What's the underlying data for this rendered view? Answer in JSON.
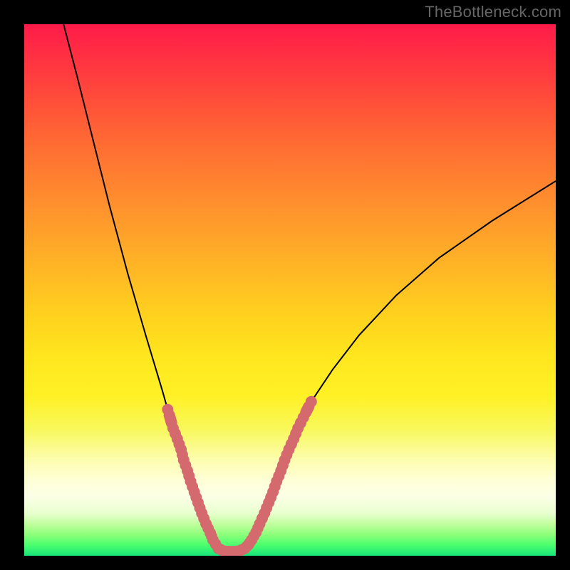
{
  "attribution": "TheBottleneck.com",
  "chart_data": {
    "type": "line",
    "title": "",
    "xlabel": "",
    "ylabel": "",
    "xlim": [
      0,
      100
    ],
    "ylim": [
      0,
      100
    ],
    "grid": false,
    "legend": false,
    "background": "red-yellow-green vertical gradient",
    "description": "Bottleneck-vs-configuration curve. Two branches of a black curve descend steeply from the top edges toward a minimum at roughly x≈38. Pink bead markers highlight the near-optimal band on both branches in the lower portion.",
    "series": [
      {
        "name": "left-branch",
        "points": [
          {
            "x": 7.4,
            "y": 100.0
          },
          {
            "x": 10.0,
            "y": 90.0
          },
          {
            "x": 13.0,
            "y": 78.0
          },
          {
            "x": 16.0,
            "y": 66.0
          },
          {
            "x": 19.5,
            "y": 53.0
          },
          {
            "x": 23.0,
            "y": 41.0
          },
          {
            "x": 26.0,
            "y": 31.0
          },
          {
            "x": 27.0,
            "y": 27.5
          },
          {
            "x": 28.8,
            "y": 22.0
          },
          {
            "x": 30.0,
            "y": 18.0
          },
          {
            "x": 31.3,
            "y": 14.0
          },
          {
            "x": 32.7,
            "y": 10.0
          },
          {
            "x": 34.2,
            "y": 6.0
          },
          {
            "x": 35.5,
            "y": 3.0
          },
          {
            "x": 36.5,
            "y": 1.4
          },
          {
            "x": 37.5,
            "y": 0.9
          }
        ]
      },
      {
        "name": "right-branch",
        "points": [
          {
            "x": 40.5,
            "y": 0.9
          },
          {
            "x": 41.5,
            "y": 1.4
          },
          {
            "x": 42.8,
            "y": 3.0
          },
          {
            "x": 44.3,
            "y": 6.0
          },
          {
            "x": 46.0,
            "y": 10.0
          },
          {
            "x": 47.5,
            "y": 14.0
          },
          {
            "x": 49.0,
            "y": 18.0
          },
          {
            "x": 50.7,
            "y": 22.0
          },
          {
            "x": 52.5,
            "y": 26.0
          },
          {
            "x": 54.0,
            "y": 29.0
          },
          {
            "x": 58.0,
            "y": 35.0
          },
          {
            "x": 63.0,
            "y": 41.5
          },
          {
            "x": 70.0,
            "y": 49.0
          },
          {
            "x": 78.0,
            "y": 56.0
          },
          {
            "x": 88.0,
            "y": 63.0
          },
          {
            "x": 100.0,
            "y": 70.5
          }
        ]
      }
    ],
    "markers": {
      "name": "highlighted-points",
      "color": "#d46a6e",
      "points": [
        {
          "x": 27.0,
          "y": 27.5
        },
        {
          "x": 28.0,
          "y": 24.0
        },
        {
          "x": 28.8,
          "y": 22.0
        },
        {
          "x": 29.5,
          "y": 20.0
        },
        {
          "x": 30.0,
          "y": 18.0
        },
        {
          "x": 30.7,
          "y": 16.0
        },
        {
          "x": 31.3,
          "y": 14.0
        },
        {
          "x": 32.0,
          "y": 12.0
        },
        {
          "x": 32.7,
          "y": 10.0
        },
        {
          "x": 33.4,
          "y": 8.0
        },
        {
          "x": 34.2,
          "y": 6.0
        },
        {
          "x": 35.0,
          "y": 4.3
        },
        {
          "x": 35.5,
          "y": 3.0
        },
        {
          "x": 36.5,
          "y": 1.4
        },
        {
          "x": 37.5,
          "y": 0.9
        },
        {
          "x": 38.5,
          "y": 0.8
        },
        {
          "x": 39.5,
          "y": 0.8
        },
        {
          "x": 40.5,
          "y": 0.9
        },
        {
          "x": 41.5,
          "y": 1.4
        },
        {
          "x": 42.2,
          "y": 2.1
        },
        {
          "x": 42.8,
          "y": 3.0
        },
        {
          "x": 43.6,
          "y": 4.4
        },
        {
          "x": 44.3,
          "y": 6.0
        },
        {
          "x": 45.2,
          "y": 8.0
        },
        {
          "x": 46.0,
          "y": 10.0
        },
        {
          "x": 46.8,
          "y": 12.0
        },
        {
          "x": 47.5,
          "y": 14.0
        },
        {
          "x": 48.3,
          "y": 16.0
        },
        {
          "x": 49.0,
          "y": 18.0
        },
        {
          "x": 49.8,
          "y": 20.0
        },
        {
          "x": 50.7,
          "y": 22.0
        },
        {
          "x": 51.5,
          "y": 24.0
        },
        {
          "x": 52.5,
          "y": 26.0
        },
        {
          "x": 54.0,
          "y": 29.0
        }
      ]
    }
  }
}
